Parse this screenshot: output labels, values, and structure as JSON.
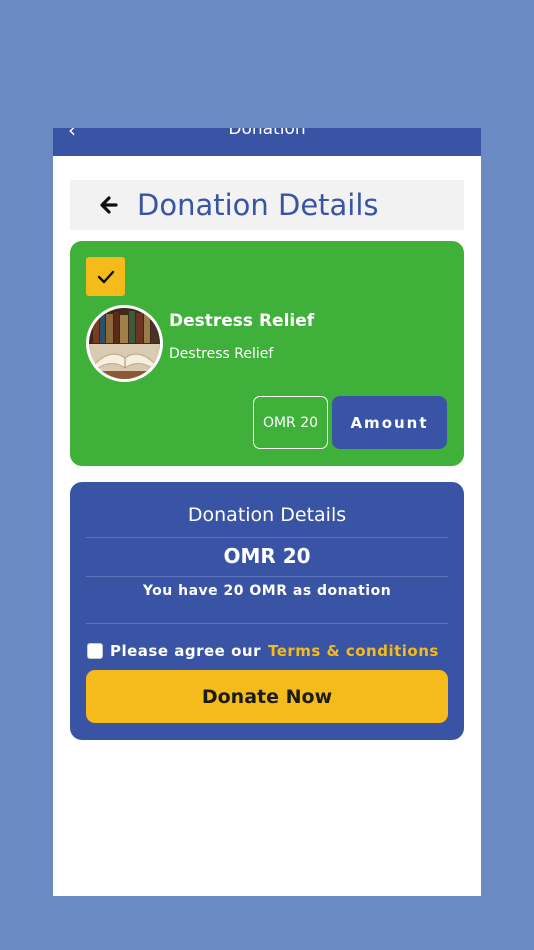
{
  "appbar": {
    "back_icon": "chevron-left-icon",
    "title": "Donation"
  },
  "header": {
    "back_icon": "arrow-left-icon",
    "title": "Donation Details"
  },
  "cause": {
    "selected": true,
    "check_icon": "check-icon",
    "name": "Destress Relief",
    "subtitle": "Destress Relief",
    "amount_value": "OMR 20",
    "amount_button": "Amount"
  },
  "summary": {
    "title": "Donation Details",
    "amount": "OMR 20",
    "note": "You have 20 OMR as donation",
    "agree_text": "Please agree our",
    "terms_link": "Terms & conditions",
    "agree_checked": false,
    "donate_button": "Donate Now"
  },
  "colors": {
    "primary_blue": "#3953a5",
    "accent_yellow": "#f5bb1b",
    "card_green": "#3fb039",
    "background": "#6a8ac4"
  }
}
